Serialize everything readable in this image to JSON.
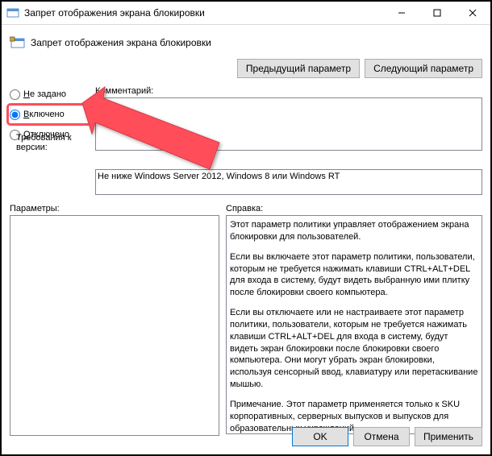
{
  "window": {
    "title": "Запрет отображения экрана блокировки"
  },
  "header": {
    "title": "Запрет отображения экрана блокировки"
  },
  "nav": {
    "prev": "Предыдущий параметр",
    "next": "Следующий параметр"
  },
  "radios": {
    "not_configured": "Не задано",
    "enabled": "Включено",
    "disabled": "Отключено"
  },
  "labels": {
    "comment": "Комментарий:",
    "supported": "Требования к версии:",
    "options": "Параметры:",
    "help": "Справка:"
  },
  "fields": {
    "comment": "",
    "supported": "Не ниже Windows Server 2012, Windows 8 или Windows RT"
  },
  "help": {
    "p1": "Этот параметр политики управляет отображением экрана блокировки для пользователей.",
    "p2": "Если вы включаете этот параметр политики, пользователи, которым не требуется нажимать клавиши CTRL+ALT+DEL для входа в систему, будут видеть выбранную ими плитку после блокировки своего компьютера.",
    "p3": "Если вы отключаете или не настраиваете этот параметр политики, пользователи, которым не требуется нажимать клавиши CTRL+ALT+DEL для входа в систему, будут видеть экран блокировки после блокировки своего компьютера. Они могут убрать экран блокировки, используя сенсорный ввод, клавиатуру или перетаскивание мышью.",
    "p4": "Примечание. Этот параметр применяется только к SKU корпоративных, серверных выпусков и выпусков для образовательных учреждений."
  },
  "footer": {
    "ok": "OK",
    "cancel": "Отмена",
    "apply": "Применить"
  }
}
